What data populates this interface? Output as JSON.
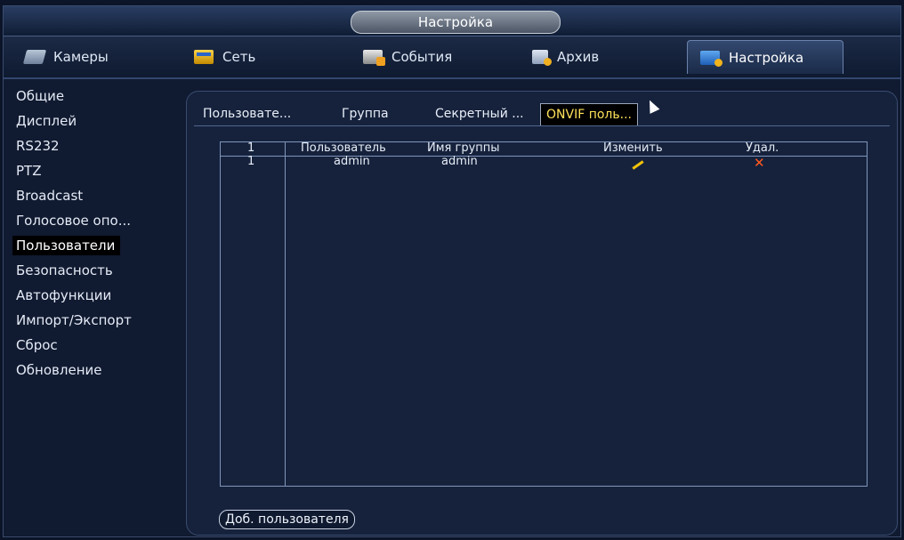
{
  "window": {
    "title": "Настройка"
  },
  "topnav": [
    {
      "label": "Камеры",
      "icon": "camera-icon"
    },
    {
      "label": "Сеть",
      "icon": "network-icon"
    },
    {
      "label": "События",
      "icon": "events-icon"
    },
    {
      "label": "Архив",
      "icon": "archive-icon"
    },
    {
      "label": "Настройка",
      "icon": "settings-icon",
      "active": true
    }
  ],
  "sidebar": {
    "items": [
      {
        "label": "Общие"
      },
      {
        "label": "Дисплей"
      },
      {
        "label": "RS232"
      },
      {
        "label": "PTZ"
      },
      {
        "label": "Broadcast"
      },
      {
        "label": "Голосовое опо..."
      },
      {
        "label": "Пользователи",
        "active": true
      },
      {
        "label": "Безопасность"
      },
      {
        "label": "Автофункции"
      },
      {
        "label": "Импорт/Экспорт"
      },
      {
        "label": "Сброс"
      },
      {
        "label": "Обновление"
      }
    ]
  },
  "subtabs": [
    {
      "label": "Пользовате..."
    },
    {
      "label": "Группа"
    },
    {
      "label": "Секретный ..."
    },
    {
      "label": "ONVIF поль...",
      "active": true
    }
  ],
  "table": {
    "headers": {
      "num": "1",
      "user": "Пользователь",
      "group": "Имя группы",
      "edit": "Изменить",
      "delete": "Удал."
    },
    "rows": [
      {
        "num": "1",
        "user": "admin",
        "group": "admin",
        "edit_icon": "pencil-icon",
        "delete_icon": "delete-icon"
      }
    ]
  },
  "actions": {
    "add_user": "Доб. пользователя"
  },
  "colors": {
    "accent": "#ffe25a",
    "background": "#101a30",
    "delete": "#ff5a1f",
    "edit": "#f2c20a"
  }
}
